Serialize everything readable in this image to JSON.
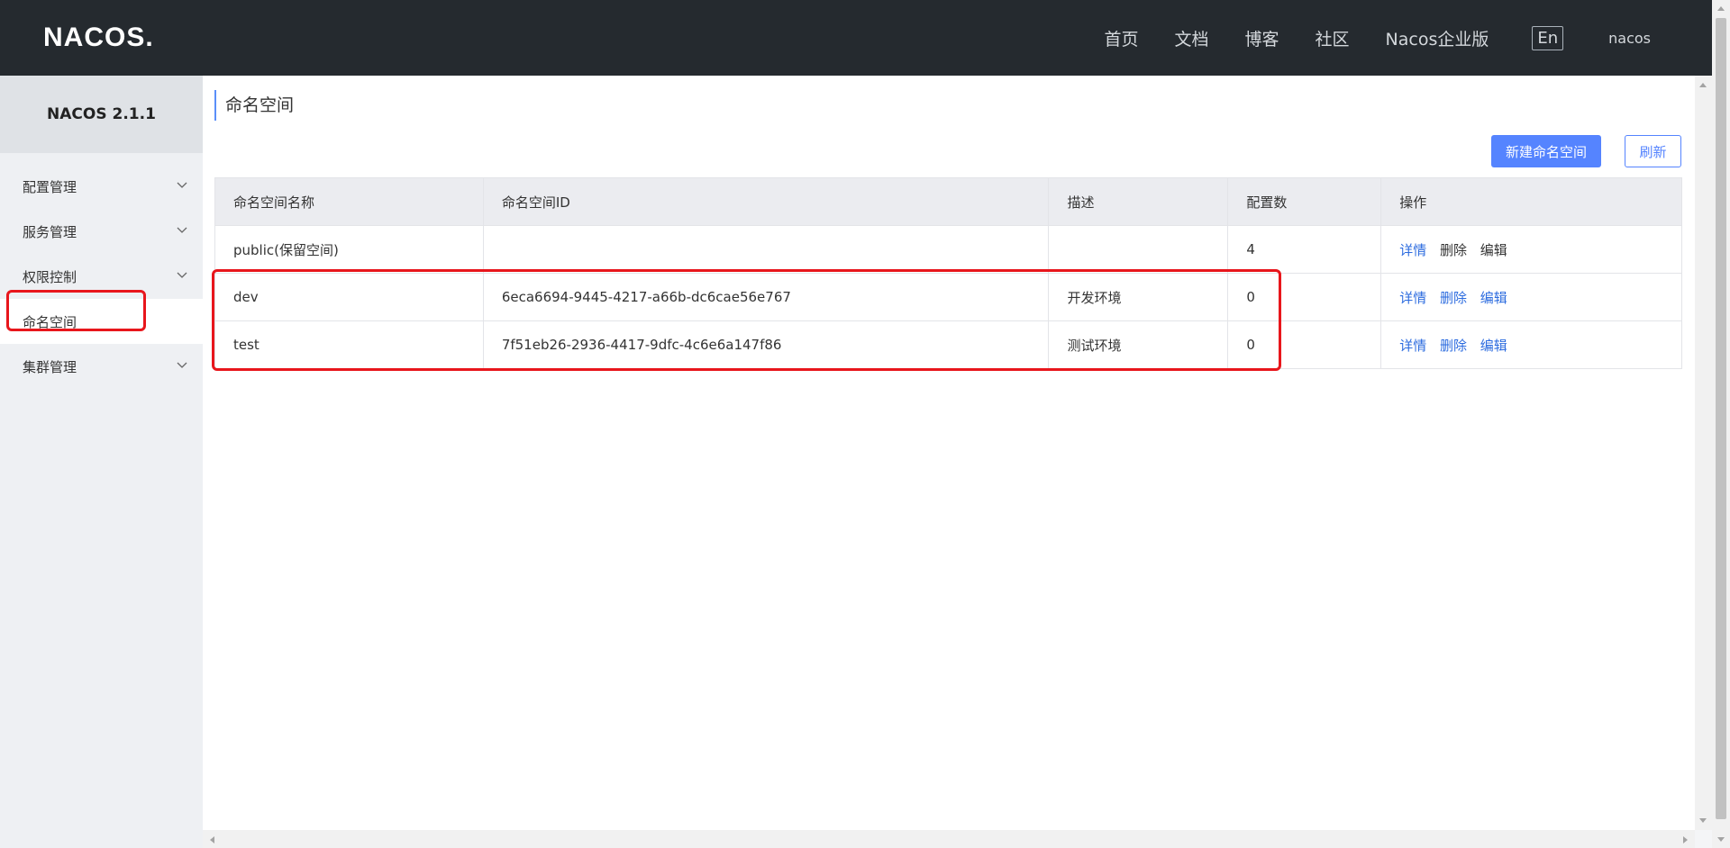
{
  "header": {
    "logo": "NACOS.",
    "nav": [
      "首页",
      "文档",
      "博客",
      "社区",
      "Nacos企业版"
    ],
    "lang": "En",
    "user": "nacos"
  },
  "sidebar": {
    "version": "NACOS 2.1.1",
    "items": [
      {
        "label": "配置管理",
        "expandable": true
      },
      {
        "label": "服务管理",
        "expandable": true
      },
      {
        "label": "权限控制",
        "expandable": true
      },
      {
        "label": "命名空间",
        "expandable": false,
        "active": true
      },
      {
        "label": "集群管理",
        "expandable": true
      }
    ]
  },
  "page": {
    "title": "命名空间",
    "new_button": "新建命名空间",
    "refresh_button": "刷新"
  },
  "table": {
    "headers": [
      "命名空间名称",
      "命名空间ID",
      "描述",
      "配置数",
      "操作"
    ],
    "rows": [
      {
        "name": "public(保留空间)",
        "id": "",
        "desc": "",
        "count": "4",
        "ops": [
          "详情",
          "删除",
          "编辑"
        ]
      },
      {
        "name": "dev",
        "id": "6eca6694-9445-4217-a66b-dc6cae56e767",
        "desc": "开发环境",
        "count": "0",
        "ops": [
          "详情",
          "删除",
          "编辑"
        ]
      },
      {
        "name": "test",
        "id": "7f51eb26-2936-4417-9dfc-4c6e6a147f86",
        "desc": "测试环境",
        "count": "0",
        "ops": [
          "详情",
          "删除",
          "编辑"
        ]
      }
    ]
  },
  "colors": {
    "header_bg": "#252a2f",
    "primary": "#5584ff",
    "link": "#2d6cdf",
    "highlight": "#e8161c"
  }
}
